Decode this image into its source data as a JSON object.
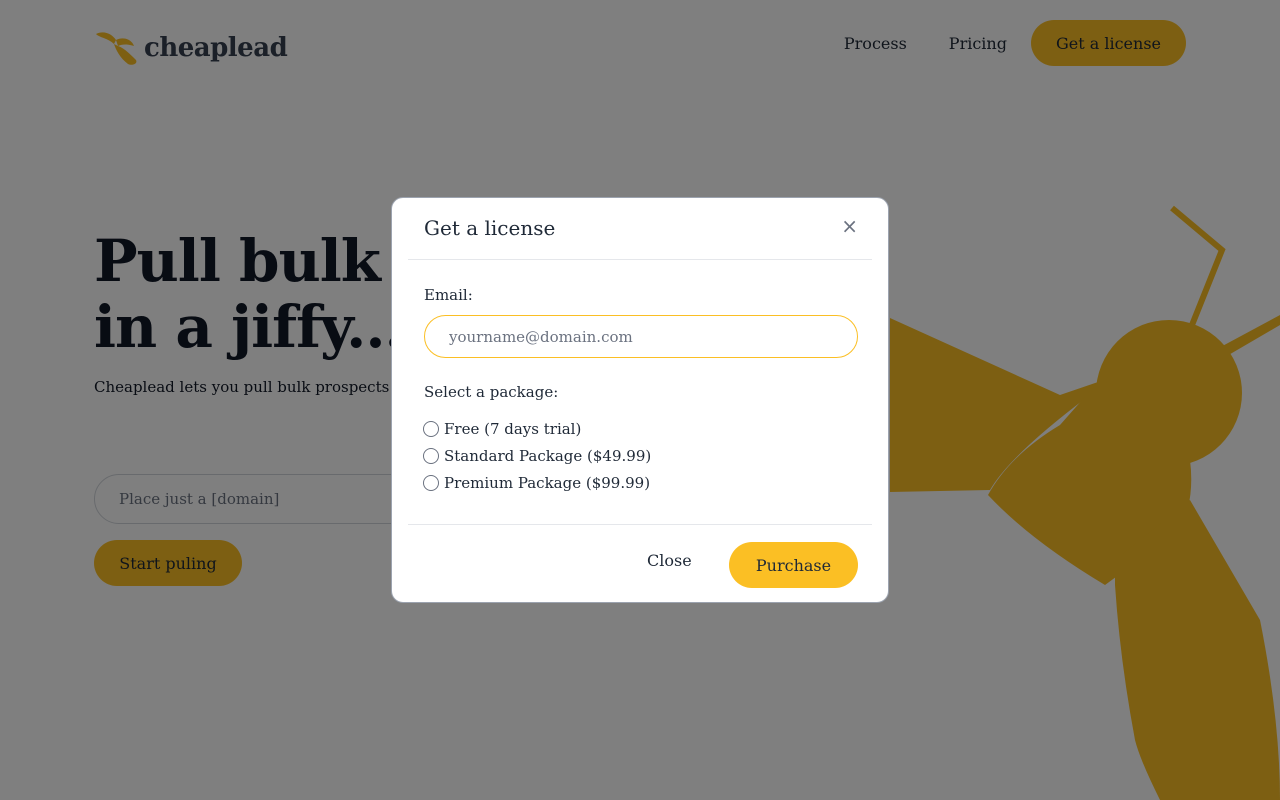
{
  "header": {
    "logo_text": "cheaplead",
    "nav": [
      "Process",
      "Pricing"
    ],
    "cta_label": "Get a license"
  },
  "hero": {
    "title_line1": "Pull bulk leads",
    "title_line2": "in a jiffy...",
    "description": "Cheaplead lets you pull bulk prospects that match the needs of your business.",
    "input_placeholder": "Place just a [domain]",
    "button_label": "Start puling"
  },
  "modal": {
    "title": "Get a license",
    "close_icon": "×",
    "email_label": "Email:",
    "email_placeholder": "yourname@domain.com",
    "email_value": "",
    "package_label": "Select a package:",
    "packages": [
      "Free (7 days trial)",
      "Standard Package ($49.99)",
      "Premium Package ($99.99)"
    ],
    "close_label": "Close",
    "purchase_label": "Purchase"
  },
  "colors": {
    "accent": "#fbbf24",
    "overlay": "rgba(0,0,0,0.5)",
    "text": "#1f2937"
  }
}
